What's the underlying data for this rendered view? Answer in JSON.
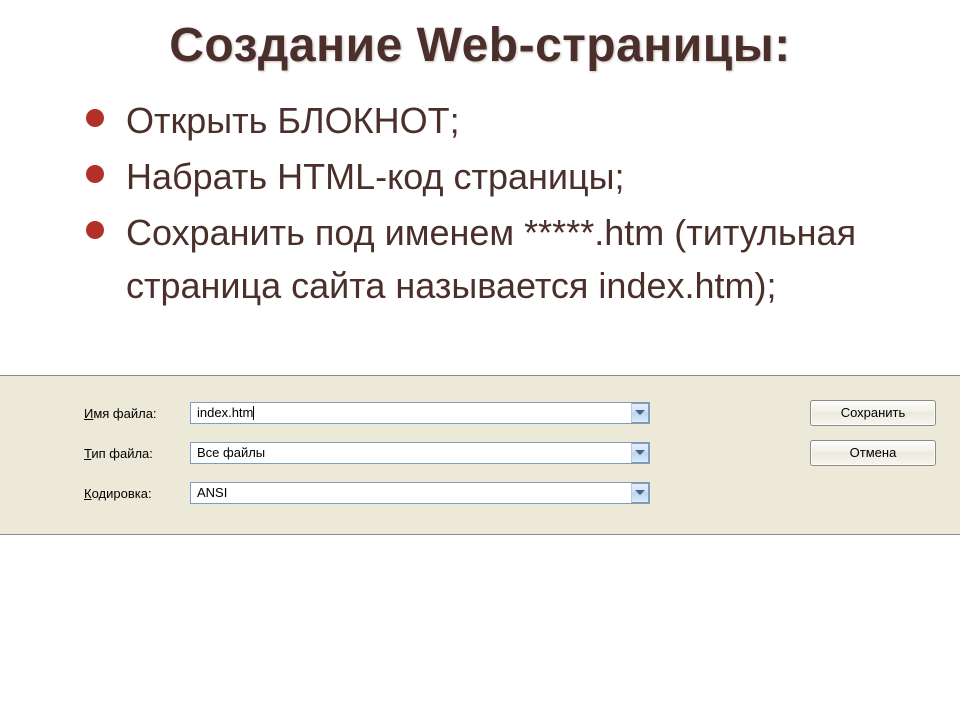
{
  "slide": {
    "title": "Создание Web-страницы:",
    "bullets": [
      "Открыть  БЛОКНОТ;",
      "Набрать HTML-код страницы;",
      "Сохранить под именем *****.htm (титульная страница сайта называется index.htm);"
    ]
  },
  "dialog": {
    "labels": {
      "filename_pre": "",
      "filename_ul": "И",
      "filename_post": "мя файла:",
      "filetype_pre": "",
      "filetype_ul": "Т",
      "filetype_post": "ип файла:",
      "encoding_pre": "",
      "encoding_ul": "К",
      "encoding_post": "одировка:"
    },
    "values": {
      "filename": "index.htm",
      "filetype": "Все файлы",
      "encoding": "ANSI"
    },
    "buttons": {
      "save": "Сохранить",
      "cancel": "Отмена"
    }
  }
}
